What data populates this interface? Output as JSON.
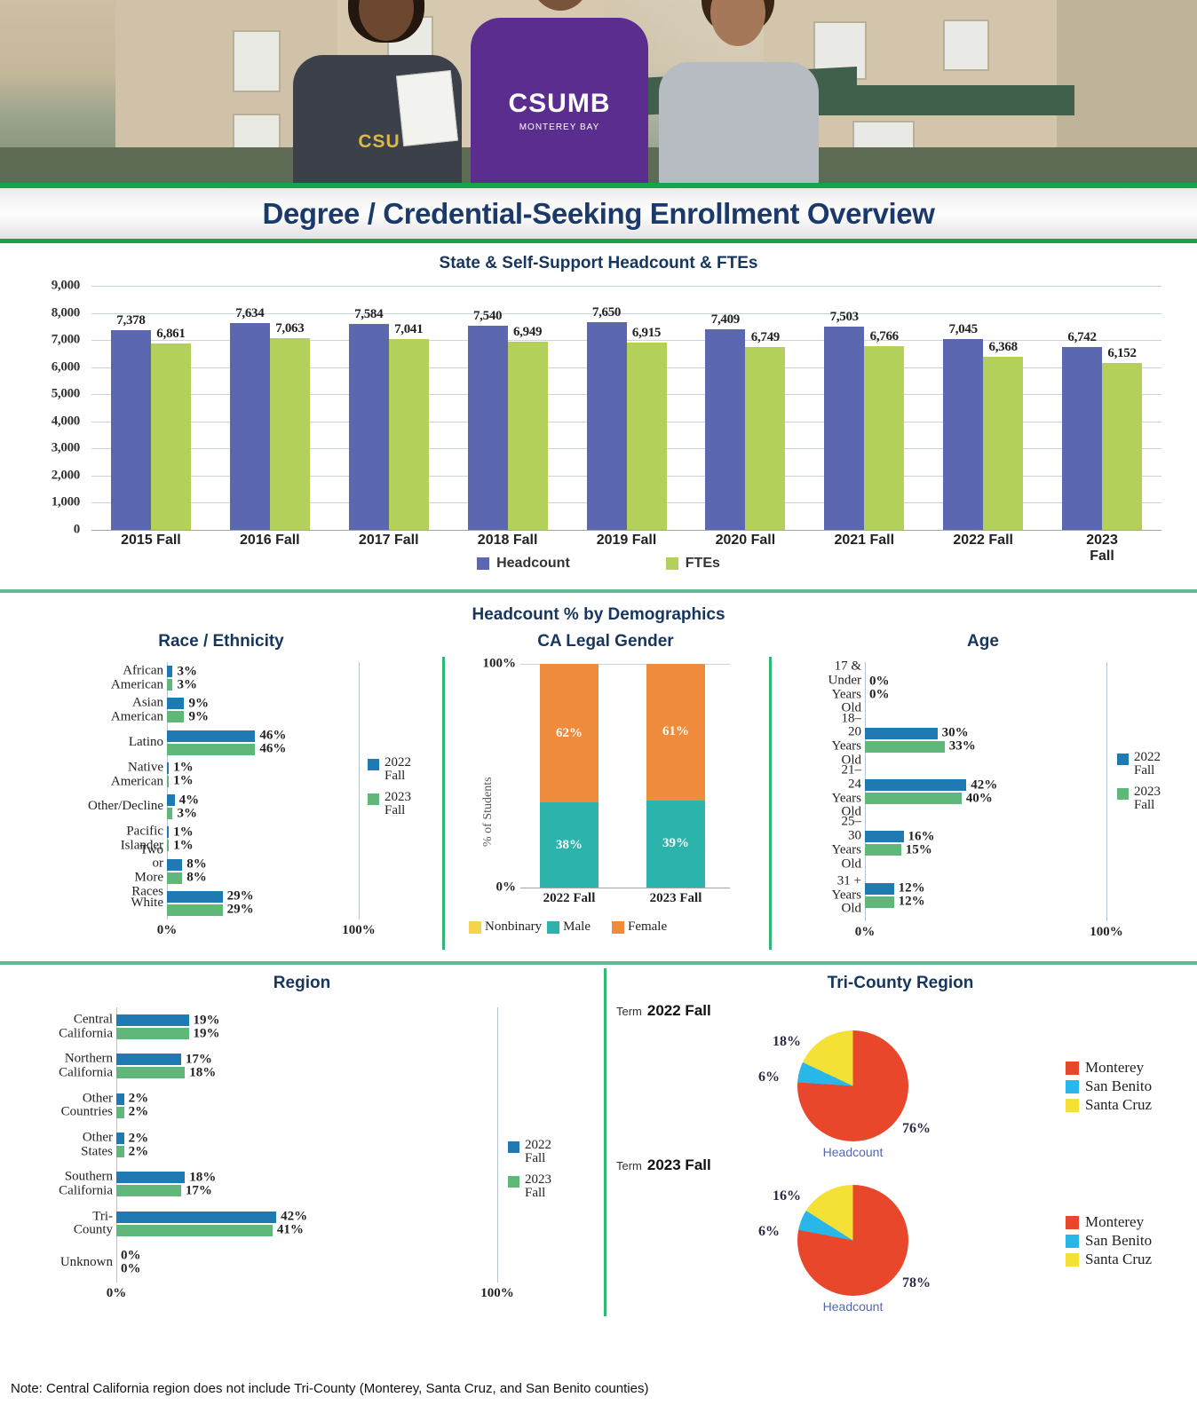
{
  "header": {
    "title": "Degree / Credential-Seeking Enrollment Overview",
    "photo_alt": "three-students-walking-icon",
    "logo_main": "CSUMB",
    "logo_sub": "MONTEREY BAY",
    "logo_left": "CSU"
  },
  "colors": {
    "headcount_bar": "#5b68b0",
    "fte_bar": "#b3d05a",
    "fall2022": "#1f7ab4",
    "fall2023": "#5fb87a",
    "nonbinary": "#f5d44e",
    "male": "#2cb3ab",
    "female": "#ef8b3c",
    "monterey": "#e8472b",
    "san_benito": "#29b6e8",
    "santa_cruz": "#f5e035",
    "title_blue": "#1b3a6b",
    "rule_green": "#16a34a",
    "divider_green": "#62b892"
  },
  "main_chart_legend": [
    {
      "label": "Headcount",
      "color": "#5b68b0"
    },
    {
      "label": "FTEs",
      "color": "#b3d05a"
    }
  ],
  "demographics_heading": "Headcount % by Demographics",
  "series_legend": [
    {
      "label": "2022\nFall",
      "color": "#1f7ab4"
    },
    {
      "label": "2023\nFall",
      "color": "#5fb87a"
    }
  ],
  "axis_ticks": {
    "zero": "0%",
    "hundred": "100%"
  },
  "tri_county": {
    "title": "Tri-County Region",
    "term_word": "Term",
    "caption": "Headcount",
    "panels": [
      {
        "term": "2022 Fall"
      },
      {
        "term": "2023 Fall"
      }
    ],
    "legend": [
      {
        "label": "Monterey",
        "color": "#e8472b"
      },
      {
        "label": "San Benito",
        "color": "#29b6e8"
      },
      {
        "label": "Santa Cruz",
        "color": "#f5e035"
      }
    ]
  },
  "footnote": "Note: Central California region does not include Tri-County (Monterey, Santa Cruz, and San Benito counties)",
  "chart_data": [
    {
      "id": "headcount_ftes",
      "type": "bar",
      "title": "State & Self-Support Headcount & FTEs",
      "xlabel": "",
      "ylabel": "",
      "ylim": [
        0,
        9000
      ],
      "yticks": [
        "0",
        "1,000",
        "2,000",
        "3,000",
        "4,000",
        "5,000",
        "6,000",
        "7,000",
        "8,000",
        "9,000"
      ],
      "grid": true,
      "legend_position": "bottom",
      "categories": [
        "2015 Fall",
        "2016 Fall",
        "2017 Fall",
        "2018 Fall",
        "2019 Fall",
        "2020 Fall",
        "2021 Fall",
        "2022 Fall",
        "2023 Fall"
      ],
      "series": [
        {
          "name": "Headcount",
          "color": "#5b68b0",
          "values": [
            7378,
            7634,
            7584,
            7540,
            7650,
            7409,
            7503,
            7045,
            6742
          ],
          "labels": [
            "7,378",
            "7,634",
            "7,584",
            "7,540",
            "7,650",
            "7,409",
            "7,503",
            "7,045",
            "6,742"
          ]
        },
        {
          "name": "FTEs",
          "color": "#b3d05a",
          "values": [
            6861,
            7063,
            7041,
            6949,
            6915,
            6749,
            6766,
            6368,
            6152
          ],
          "labels": [
            "6,861",
            "7,063",
            "7,041",
            "6,949",
            "6,915",
            "6,749",
            "6,766",
            "6,368",
            "6,152"
          ]
        }
      ]
    },
    {
      "id": "race_ethnicity",
      "type": "bar",
      "orientation": "horizontal",
      "title": "Race / Ethnicity",
      "xlim": [
        0,
        100
      ],
      "xticks": [
        "0%",
        "100%"
      ],
      "legend_position": "right",
      "categories": [
        "African American",
        "Asian American",
        "Latino",
        "Native American",
        "Other/Decline",
        "Pacific Islander",
        "Two or More Races",
        "White"
      ],
      "series": [
        {
          "name": "2022 Fall",
          "color": "#1f7ab4",
          "values": [
            3,
            9,
            46,
            1,
            4,
            1,
            8,
            29
          ],
          "labels": [
            "3%",
            "9%",
            "46%",
            "1%",
            "4%",
            "1%",
            "8%",
            "29%"
          ]
        },
        {
          "name": "2023 Fall",
          "color": "#5fb87a",
          "values": [
            3,
            9,
            46,
            1,
            3,
            1,
            8,
            29
          ],
          "labels": [
            "3%",
            "9%",
            "46%",
            "1%",
            "3%",
            "1%",
            "8%",
            "29%"
          ]
        }
      ]
    },
    {
      "id": "ca_legal_gender",
      "type": "bar",
      "stacked": true,
      "title": "CA Legal Gender",
      "ylabel": "% of Students",
      "ylim": [
        0,
        100
      ],
      "yticks": [
        "0%",
        "100%"
      ],
      "legend_position": "bottom",
      "categories": [
        "2022 Fall",
        "2023 Fall"
      ],
      "series": [
        {
          "name": "Nonbinary",
          "color": "#f5d44e",
          "values": [
            0,
            0
          ],
          "labels": [
            "",
            ""
          ]
        },
        {
          "name": "Male",
          "color": "#2cb3ab",
          "values": [
            38,
            39
          ],
          "labels": [
            "38%",
            "39%"
          ]
        },
        {
          "name": "Female",
          "color": "#ef8b3c",
          "values": [
            62,
            61
          ],
          "labels": [
            "62%",
            "61%"
          ]
        }
      ]
    },
    {
      "id": "age",
      "type": "bar",
      "orientation": "horizontal",
      "title": "Age",
      "xlim": [
        0,
        100
      ],
      "xticks": [
        "0%",
        "100%"
      ],
      "legend_position": "right",
      "categories": [
        "17 &\nUnder\nYears Old",
        "18–20\nYears Old",
        "21–24\nYears Old",
        "25–30\nYears Old",
        "31 +\nYears Old"
      ],
      "series": [
        {
          "name": "2022 Fall",
          "color": "#1f7ab4",
          "values": [
            0,
            30,
            42,
            16,
            12
          ],
          "labels": [
            "0%",
            "30%",
            "42%",
            "16%",
            "12%"
          ]
        },
        {
          "name": "2023 Fall",
          "color": "#5fb87a",
          "values": [
            0,
            33,
            40,
            15,
            12
          ],
          "labels": [
            "0%",
            "33%",
            "40%",
            "15%",
            "12%"
          ]
        }
      ]
    },
    {
      "id": "region",
      "type": "bar",
      "orientation": "horizontal",
      "title": "Region",
      "xlim": [
        0,
        100
      ],
      "xticks": [
        "0%",
        "100%"
      ],
      "legend_position": "right",
      "categories": [
        "Central\nCalifornia",
        "Northern\nCalifornia",
        "Other\nCountries",
        "Other\nStates",
        "Southern\nCalifornia",
        "Tri-County",
        "Unknown"
      ],
      "series": [
        {
          "name": "2022 Fall",
          "color": "#1f7ab4",
          "values": [
            19,
            17,
            2,
            2,
            18,
            42,
            0
          ],
          "labels": [
            "19%",
            "17%",
            "2%",
            "2%",
            "18%",
            "42%",
            "0%"
          ]
        },
        {
          "name": "2023 Fall",
          "color": "#5fb87a",
          "values": [
            19,
            18,
            2,
            2,
            17,
            41,
            0
          ],
          "labels": [
            "19%",
            "18%",
            "2%",
            "2%",
            "17%",
            "41%",
            "0%"
          ]
        }
      ]
    },
    {
      "id": "tri_county_2022",
      "type": "pie",
      "title": "Tri-County Region",
      "term": "2022 Fall",
      "caption": "Headcount",
      "labels": [
        "Monterey",
        "San Benito",
        "Santa Cruz"
      ],
      "values": [
        76,
        6,
        18
      ],
      "value_labels": [
        "76%",
        "6%",
        "18%"
      ],
      "colors": [
        "#e8472b",
        "#29b6e8",
        "#f5e035"
      ]
    },
    {
      "id": "tri_county_2023",
      "type": "pie",
      "title": "Tri-County Region",
      "term": "2023 Fall",
      "caption": "Headcount",
      "labels": [
        "Monterey",
        "San Benito",
        "Santa Cruz"
      ],
      "values": [
        78,
        6,
        16
      ],
      "value_labels": [
        "78%",
        "6%",
        "16%"
      ],
      "colors": [
        "#e8472b",
        "#29b6e8",
        "#f5e035"
      ]
    }
  ]
}
